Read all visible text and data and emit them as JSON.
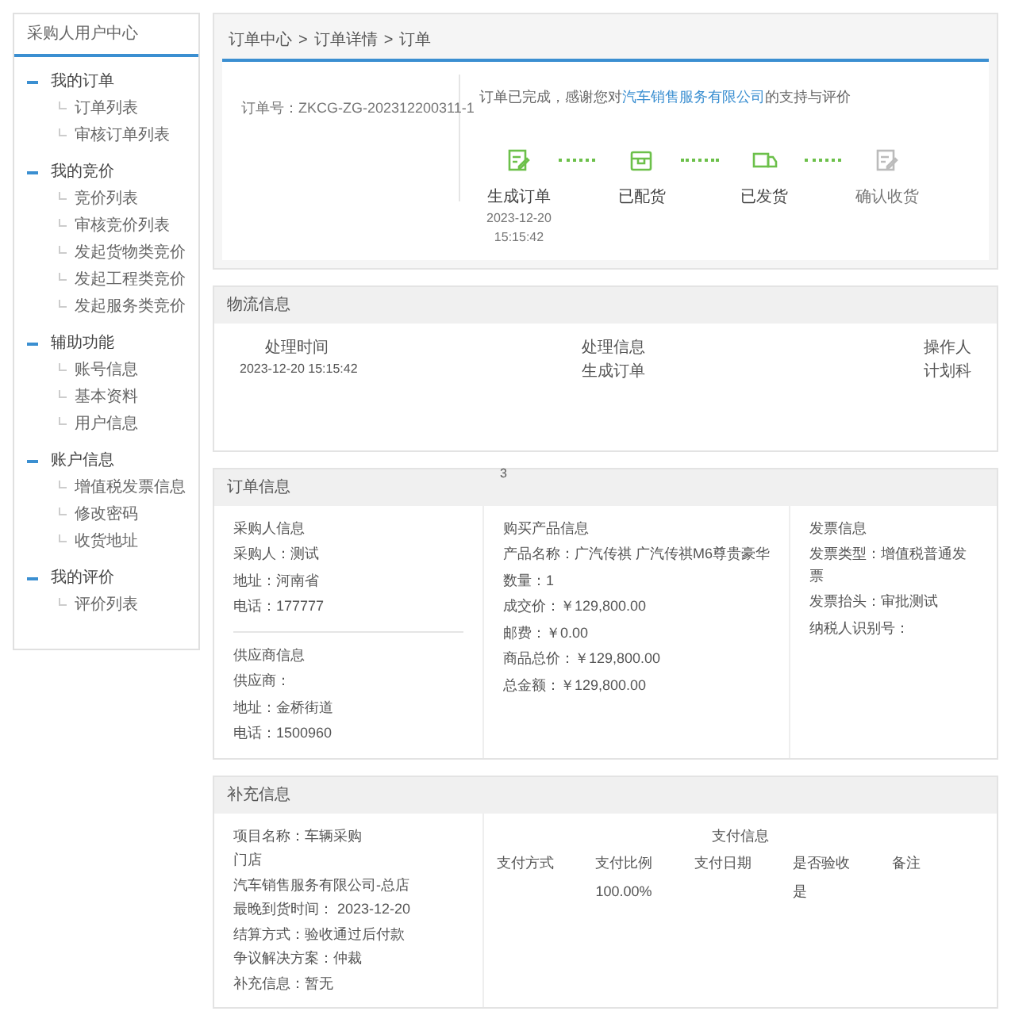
{
  "sidebar": {
    "title": "采购人用户中心",
    "groups": [
      {
        "label": "我的订单",
        "expanded": true,
        "children": [
          {
            "label": "订单列表"
          },
          {
            "label": "审核订单列表"
          }
        ]
      },
      {
        "label": "我的竞价",
        "expanded": true,
        "children": [
          {
            "label": "竞价列表"
          },
          {
            "label": "审核竞价列表"
          },
          {
            "label": "发起货物类竞价"
          },
          {
            "label": "发起工程类竞价"
          },
          {
            "label": "发起服务类竞价"
          }
        ]
      },
      {
        "label": "辅助功能",
        "expanded": true,
        "children": [
          {
            "label": "账号信息"
          },
          {
            "label": "基本资料"
          },
          {
            "label": "用户信息"
          }
        ]
      },
      {
        "label": "账户信息",
        "expanded": true,
        "children": [
          {
            "label": "增值税发票信息"
          },
          {
            "label": "修改密码"
          },
          {
            "label": "收货地址"
          }
        ]
      },
      {
        "label": "我的评价",
        "expanded": true,
        "children": [
          {
            "label": "评价列表"
          }
        ]
      }
    ]
  },
  "breadcrumb": {
    "separator": ">",
    "items": [
      "订单中心",
      "订单详情",
      "订单"
    ]
  },
  "order_number": "订单号：ZKCG-ZG-202312200311-1",
  "message": {
    "before": "订单已完成，感谢您对",
    "link": "汽车销售服务有限公司",
    "after": "的支持与评价"
  },
  "steps": [
    {
      "kind": "document",
      "label": "生成订单",
      "done": true,
      "date": "2023-12-20",
      "time": "15:15:42"
    },
    {
      "kind": "box",
      "label": "已配货",
      "done": true
    },
    {
      "kind": "truck",
      "label": "已发货",
      "done": true
    },
    {
      "kind": "document",
      "label": "确认收货",
      "done": false
    }
  ],
  "logistics": {
    "title": "物流信息",
    "columns": [
      "处理时间",
      "处理信息",
      "操作人"
    ],
    "rows": [
      [
        "2023-12-20 15:15:42",
        "生成订单",
        "计划科"
      ]
    ]
  },
  "order_info": {
    "title": "订单信息",
    "marker": "3",
    "buyer": {
      "title": "采购人信息",
      "lines": [
        "采购人：测试",
        "地址：河南省",
        "电话：177777"
      ]
    },
    "supplier": {
      "title": "供应商信息",
      "lines": [
        "供应商：",
        "地址：金桥街道",
        "电话：1500960"
      ]
    },
    "product": {
      "title": "购买产品信息",
      "lines": [
        "产品名称：广汽传祺 广汽传祺M6尊贵豪华",
        "数量：1",
        "成交价：￥129,800.00",
        "邮费：￥0.00",
        "商品总价：￥129,800.00",
        "总金额：￥129,800.00"
      ]
    },
    "invoice": {
      "title": "发票信息",
      "lines": [
        "发票类型：增值税普通发票",
        "发票抬头：审批测试",
        "纳税人识别号："
      ]
    }
  },
  "supplement": {
    "title": "补充信息",
    "lines": [
      "项目名称：车辆采购",
      "门店",
      "汽车销售服务有限公司-总店",
      "最晚到货时间：  2023-12-20",
      "结算方式：验收通过后付款",
      "争议解决方案：仲裁",
      "补充信息：暂无"
    ],
    "payment": {
      "title": "支付信息",
      "columns": [
        "支付方式",
        "支付比例",
        "支付日期",
        "是否验收",
        "备注"
      ],
      "rows": [
        [
          null,
          "100.00%",
          null,
          "是",
          null
        ]
      ]
    }
  }
}
